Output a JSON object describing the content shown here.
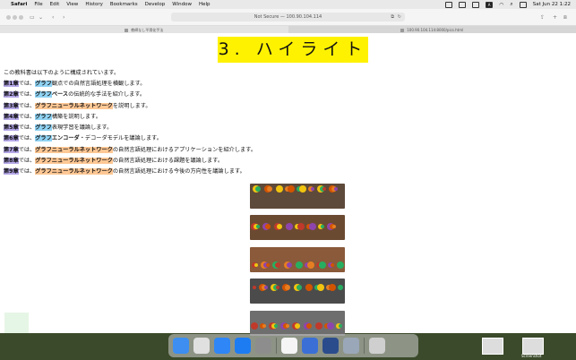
{
  "menubar": {
    "app": "Safari",
    "items": [
      "File",
      "Edit",
      "View",
      "History",
      "Bookmarks",
      "Develop",
      "Window",
      "Help"
    ],
    "datetime": "Sat Jun 22  1:22"
  },
  "toolbar": {
    "url": "Not Secure — 100.90.104.114"
  },
  "tabs": [
    {
      "label": "教師なし平滑化手法",
      "active": false
    },
    {
      "label": "100.90.104.114:8000/pics.html",
      "active": true
    }
  ],
  "page": {
    "heading": "3.  ハイライト",
    "intro": "この教科書は以下のように構成されています。",
    "chapters": [
      {
        "num": "第1章",
        "pre": "では、",
        "hl": "グラフ",
        "hl_color": "blue",
        "rest": "観点での自然言語処理を横観します。"
      },
      {
        "num": "第2章",
        "pre": "では、",
        "hl": "グラフ",
        "hl_color": "blue",
        "rest_bold": "ベース",
        "rest": "の伝統的な手法を紹介します。"
      },
      {
        "num": "第3章",
        "pre": "では、",
        "hl": "グラフニューラルネットワーク",
        "hl_color": "orange",
        "rest": "を説明します。"
      },
      {
        "num": "第4章",
        "pre": "では、",
        "hl": "グラフ",
        "hl_color": "blue",
        "rest": "構築を説明します。"
      },
      {
        "num": "第5章",
        "pre": "では、",
        "hl": "グラフ",
        "hl_color": "blue",
        "rest": "表現学習を議論します。"
      },
      {
        "num": "第6章",
        "pre": "では、",
        "hl": "グラフ",
        "hl_color": "blue",
        "rest_bold": "エンコーダ",
        "rest": "・デコーダモデルを議論します。"
      },
      {
        "num": "第7章",
        "pre": "では、",
        "hl": "グラフニューラルネットワーク",
        "hl_color": "orange",
        "rest": "の自然言語処理におけるアプリケーションを紹介します。"
      },
      {
        "num": "第8章",
        "pre": "では、",
        "hl": "グラフニューラルネットワーク",
        "hl_color": "orange",
        "rest": "の自然言語処理における課題を議論します。"
      },
      {
        "num": "第9章",
        "pre": "では、",
        "hl": "グラフニューラルネットワーク",
        "hl_color": "orange",
        "rest": "の自然言語処理における今後の方向性を議論します。"
      }
    ],
    "images": [
      {
        "name": "fruit-bowls-image-1",
        "tone": "#5e4a3a"
      },
      {
        "name": "fruit-bowls-image-2",
        "tone": "#6b4a32"
      },
      {
        "name": "fruit-bowls-image-3",
        "tone": "#8a5a3a"
      },
      {
        "name": "fruit-bowls-image-4",
        "tone": "#4b4b4b"
      },
      {
        "name": "fruit-bowls-image-5",
        "tone": "#6e6e6e"
      }
    ]
  },
  "dock": {
    "apps": [
      "finder-icon",
      "launchpad-icon",
      "safari-icon",
      "app-store-icon",
      "system-settings-icon",
      "freeform-icon",
      "xcode-icon",
      "preview-icon",
      "script-editor-icon",
      "trash-icon"
    ]
  },
  "desktop": {
    "screenshot_label": "Screenshot"
  },
  "colors": {
    "heading_bg": "#fff200",
    "chapter_num_bg": "#b5a7e8",
    "graph_hl": "#8fd3f4",
    "gnn_hl": "#ffc895"
  }
}
